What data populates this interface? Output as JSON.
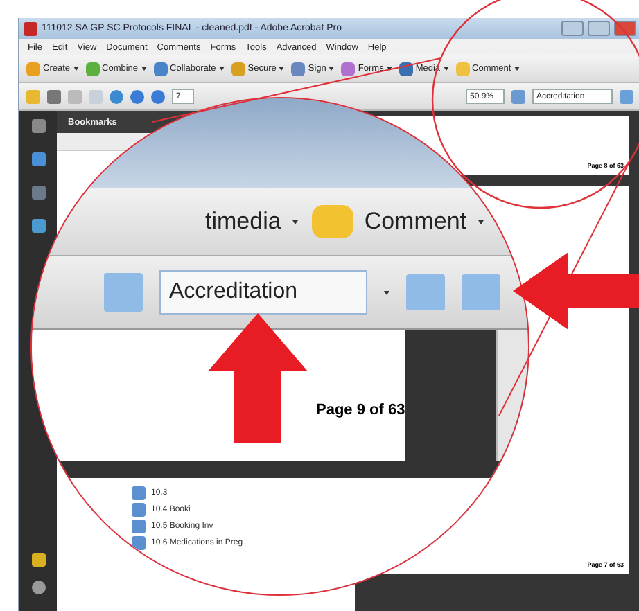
{
  "window": {
    "title": "111012 SA GP SC Protocols FINAL - cleaned.pdf - Adobe Acrobat Pro"
  },
  "menu": [
    "File",
    "Edit",
    "View",
    "Document",
    "Comments",
    "Forms",
    "Tools",
    "Advanced",
    "Window",
    "Help"
  ],
  "toolbar": [
    {
      "label": "Create"
    },
    {
      "label": "Combine"
    },
    {
      "label": "Collaborate"
    },
    {
      "label": "Secure"
    },
    {
      "label": "Sign"
    },
    {
      "label": "Forms"
    },
    {
      "label": "Media"
    },
    {
      "label": "Comment"
    }
  ],
  "navigation": {
    "page": "7",
    "zoom": "50.9%",
    "search": "Accreditation"
  },
  "panel": {
    "title": "Bookmarks"
  },
  "document": {
    "page_footers": [
      "Page 8 of 63",
      "Page 7 of 63"
    ]
  },
  "magnifier": {
    "toolbar": [
      {
        "label": "timedia"
      },
      {
        "label": "Comment"
      }
    ],
    "search": "Accreditation",
    "page_label": "Page 9 of 63",
    "bookmarks": [
      "10.3",
      "10.4 Booki",
      "10.5 Booking Inv",
      "10.6 Medications in Preg"
    ]
  }
}
